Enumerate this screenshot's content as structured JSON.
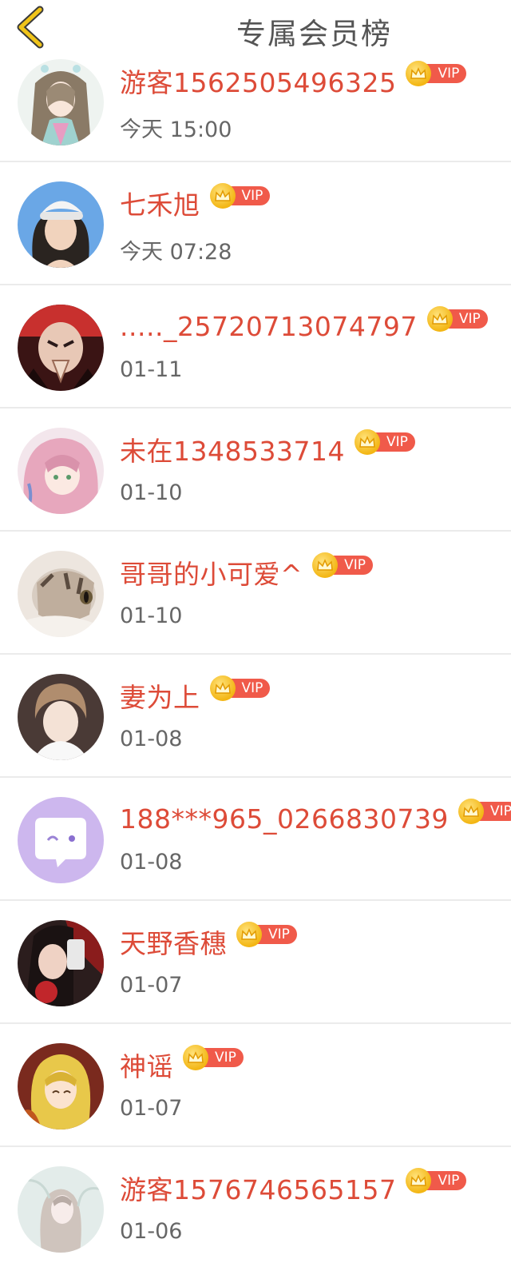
{
  "header": {
    "title": "专属会员榜",
    "back_icon": "chevron-left-icon",
    "back_color": "#f0c419"
  },
  "badge": {
    "label": "VIP",
    "icon": "crown-icon",
    "color": "#f05a4a",
    "coin_color": "#f3b614"
  },
  "members": [
    {
      "name": "游客1562505496325",
      "date": "今天 15:00",
      "avatar": "anime-girl-hanfu"
    },
    {
      "name": "七禾旭",
      "date": "今天 07:28",
      "avatar": "girl-white-beanie"
    },
    {
      "name": "....._25720713074797",
      "date": "01-11",
      "avatar": "anime-character-masked"
    },
    {
      "name": "未在1348533714",
      "date": "01-10",
      "avatar": "anime-girl-pink-hair"
    },
    {
      "name": "哥哥的小可爱^",
      "date": "01-10",
      "avatar": "kitten"
    },
    {
      "name": "妻为上",
      "date": "01-08",
      "avatar": "boy-curly-hair"
    },
    {
      "name": "188***965_0266830739",
      "date": "01-08",
      "avatar": "default-chat-bubble"
    },
    {
      "name": "天野香穗",
      "date": "01-07",
      "avatar": "girl-red-phone"
    },
    {
      "name": "神谣",
      "date": "01-07",
      "avatar": "anime-girl-blonde-braids"
    },
    {
      "name": "游客1576746565157",
      "date": "01-06",
      "avatar": "anime-girl-sketch"
    }
  ]
}
